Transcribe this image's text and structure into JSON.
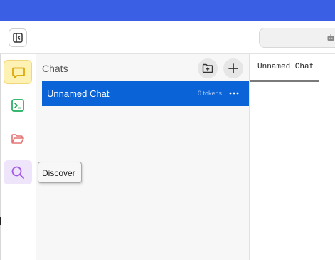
{
  "titlebar": {
    "color": "#3a5ee4"
  },
  "topbar": {
    "collapse_icon": "sidebar-collapse-icon",
    "search_icon": "robot-icon"
  },
  "rail": {
    "items": [
      {
        "id": "chat",
        "icon": "chat-bubble-icon",
        "color": "#e6b800",
        "active": true
      },
      {
        "id": "terminal",
        "icon": "terminal-icon",
        "color": "#1fae5b"
      },
      {
        "id": "files",
        "icon": "folder-open-icon",
        "color": "#e57373"
      },
      {
        "id": "discover",
        "icon": "search-icon",
        "color": "#a259e6",
        "hovered": true
      }
    ]
  },
  "chats": {
    "title": "Chats",
    "new_folder_icon": "folder-plus-icon",
    "new_chat_icon": "plus-icon",
    "items": [
      {
        "name": "Unnamed Chat",
        "tokens": "0 tokens",
        "selected": true
      }
    ]
  },
  "tooltip": {
    "text": "Discover"
  },
  "tabs": [
    {
      "label": "Unnamed Chat",
      "active": true
    }
  ],
  "colors": {
    "selected_row": "#0a64d8",
    "accent": "#3a5ee4"
  }
}
